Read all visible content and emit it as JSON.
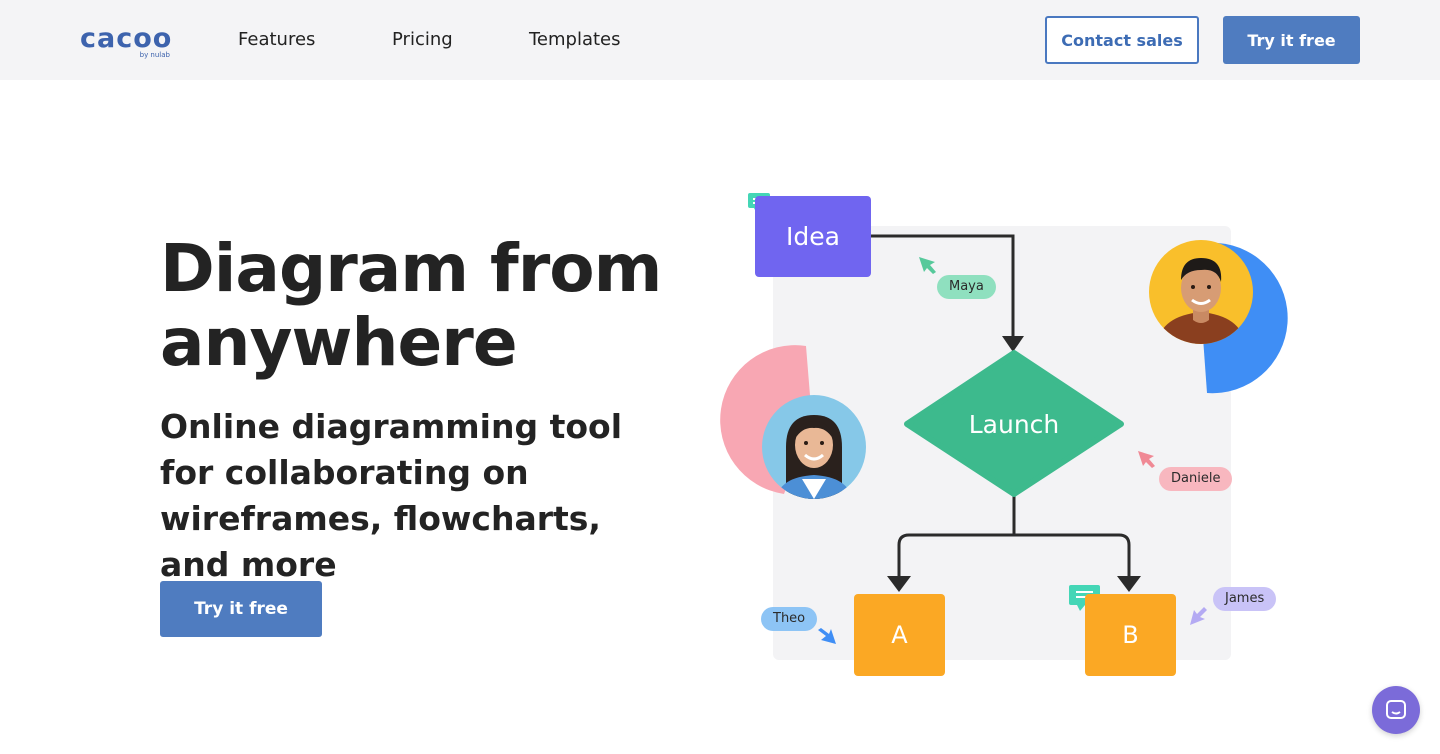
{
  "header": {
    "logo": {
      "word": "cacoo",
      "sub": "by nulab"
    },
    "nav": [
      {
        "label": "Features"
      },
      {
        "label": "Pricing"
      },
      {
        "label": "Templates"
      }
    ],
    "contact_label": "Contact sales",
    "try_label": "Try it free"
  },
  "hero": {
    "title": "Diagram from anywhere",
    "subtitle": "Online diagramming tool for collaborating on wireframes, flowcharts, and more",
    "cta_label": "Try it free"
  },
  "diagram": {
    "nodes": {
      "idea": "Idea",
      "launch": "Launch",
      "a": "A",
      "b": "B"
    },
    "cursors": {
      "maya": "Maya",
      "daniele": "Daniele",
      "theo": "Theo",
      "james": "James"
    }
  },
  "colors": {
    "brand": "#3d63ad",
    "button": "#4f7cc0",
    "idea_node": "#7065f0",
    "launch_node": "#3dba8d",
    "box_node": "#fba824",
    "maya": "#8fe0bf",
    "daniele": "#f8b7bf",
    "theo": "#8dc4f5",
    "james": "#c9c3f7",
    "chat": "#7b6bd9"
  },
  "icons": {
    "comment": "comment-icon",
    "chat": "chat-bubble-icon",
    "cursor": "cursor-arrow-icon"
  }
}
